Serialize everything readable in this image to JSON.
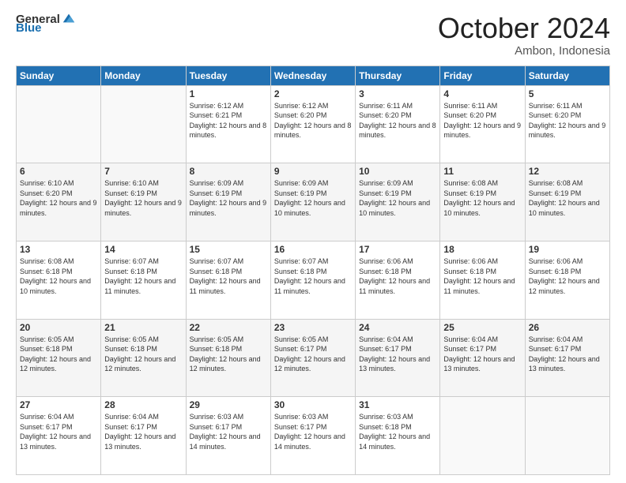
{
  "header": {
    "logo_general": "General",
    "logo_blue": "Blue",
    "month": "October 2024",
    "location": "Ambon, Indonesia"
  },
  "days_of_week": [
    "Sunday",
    "Monday",
    "Tuesday",
    "Wednesday",
    "Thursday",
    "Friday",
    "Saturday"
  ],
  "weeks": [
    [
      {
        "day": "",
        "sunrise": "",
        "sunset": "",
        "daylight": ""
      },
      {
        "day": "",
        "sunrise": "",
        "sunset": "",
        "daylight": ""
      },
      {
        "day": "1",
        "sunrise": "Sunrise: 6:12 AM",
        "sunset": "Sunset: 6:21 PM",
        "daylight": "Daylight: 12 hours and 8 minutes."
      },
      {
        "day": "2",
        "sunrise": "Sunrise: 6:12 AM",
        "sunset": "Sunset: 6:20 PM",
        "daylight": "Daylight: 12 hours and 8 minutes."
      },
      {
        "day": "3",
        "sunrise": "Sunrise: 6:11 AM",
        "sunset": "Sunset: 6:20 PM",
        "daylight": "Daylight: 12 hours and 8 minutes."
      },
      {
        "day": "4",
        "sunrise": "Sunrise: 6:11 AM",
        "sunset": "Sunset: 6:20 PM",
        "daylight": "Daylight: 12 hours and 9 minutes."
      },
      {
        "day": "5",
        "sunrise": "Sunrise: 6:11 AM",
        "sunset": "Sunset: 6:20 PM",
        "daylight": "Daylight: 12 hours and 9 minutes."
      }
    ],
    [
      {
        "day": "6",
        "sunrise": "Sunrise: 6:10 AM",
        "sunset": "Sunset: 6:20 PM",
        "daylight": "Daylight: 12 hours and 9 minutes."
      },
      {
        "day": "7",
        "sunrise": "Sunrise: 6:10 AM",
        "sunset": "Sunset: 6:19 PM",
        "daylight": "Daylight: 12 hours and 9 minutes."
      },
      {
        "day": "8",
        "sunrise": "Sunrise: 6:09 AM",
        "sunset": "Sunset: 6:19 PM",
        "daylight": "Daylight: 12 hours and 9 minutes."
      },
      {
        "day": "9",
        "sunrise": "Sunrise: 6:09 AM",
        "sunset": "Sunset: 6:19 PM",
        "daylight": "Daylight: 12 hours and 10 minutes."
      },
      {
        "day": "10",
        "sunrise": "Sunrise: 6:09 AM",
        "sunset": "Sunset: 6:19 PM",
        "daylight": "Daylight: 12 hours and 10 minutes."
      },
      {
        "day": "11",
        "sunrise": "Sunrise: 6:08 AM",
        "sunset": "Sunset: 6:19 PM",
        "daylight": "Daylight: 12 hours and 10 minutes."
      },
      {
        "day": "12",
        "sunrise": "Sunrise: 6:08 AM",
        "sunset": "Sunset: 6:19 PM",
        "daylight": "Daylight: 12 hours and 10 minutes."
      }
    ],
    [
      {
        "day": "13",
        "sunrise": "Sunrise: 6:08 AM",
        "sunset": "Sunset: 6:18 PM",
        "daylight": "Daylight: 12 hours and 10 minutes."
      },
      {
        "day": "14",
        "sunrise": "Sunrise: 6:07 AM",
        "sunset": "Sunset: 6:18 PM",
        "daylight": "Daylight: 12 hours and 11 minutes."
      },
      {
        "day": "15",
        "sunrise": "Sunrise: 6:07 AM",
        "sunset": "Sunset: 6:18 PM",
        "daylight": "Daylight: 12 hours and 11 minutes."
      },
      {
        "day": "16",
        "sunrise": "Sunrise: 6:07 AM",
        "sunset": "Sunset: 6:18 PM",
        "daylight": "Daylight: 12 hours and 11 minutes."
      },
      {
        "day": "17",
        "sunrise": "Sunrise: 6:06 AM",
        "sunset": "Sunset: 6:18 PM",
        "daylight": "Daylight: 12 hours and 11 minutes."
      },
      {
        "day": "18",
        "sunrise": "Sunrise: 6:06 AM",
        "sunset": "Sunset: 6:18 PM",
        "daylight": "Daylight: 12 hours and 11 minutes."
      },
      {
        "day": "19",
        "sunrise": "Sunrise: 6:06 AM",
        "sunset": "Sunset: 6:18 PM",
        "daylight": "Daylight: 12 hours and 12 minutes."
      }
    ],
    [
      {
        "day": "20",
        "sunrise": "Sunrise: 6:05 AM",
        "sunset": "Sunset: 6:18 PM",
        "daylight": "Daylight: 12 hours and 12 minutes."
      },
      {
        "day": "21",
        "sunrise": "Sunrise: 6:05 AM",
        "sunset": "Sunset: 6:18 PM",
        "daylight": "Daylight: 12 hours and 12 minutes."
      },
      {
        "day": "22",
        "sunrise": "Sunrise: 6:05 AM",
        "sunset": "Sunset: 6:18 PM",
        "daylight": "Daylight: 12 hours and 12 minutes."
      },
      {
        "day": "23",
        "sunrise": "Sunrise: 6:05 AM",
        "sunset": "Sunset: 6:17 PM",
        "daylight": "Daylight: 12 hours and 12 minutes."
      },
      {
        "day": "24",
        "sunrise": "Sunrise: 6:04 AM",
        "sunset": "Sunset: 6:17 PM",
        "daylight": "Daylight: 12 hours and 13 minutes."
      },
      {
        "day": "25",
        "sunrise": "Sunrise: 6:04 AM",
        "sunset": "Sunset: 6:17 PM",
        "daylight": "Daylight: 12 hours and 13 minutes."
      },
      {
        "day": "26",
        "sunrise": "Sunrise: 6:04 AM",
        "sunset": "Sunset: 6:17 PM",
        "daylight": "Daylight: 12 hours and 13 minutes."
      }
    ],
    [
      {
        "day": "27",
        "sunrise": "Sunrise: 6:04 AM",
        "sunset": "Sunset: 6:17 PM",
        "daylight": "Daylight: 12 hours and 13 minutes."
      },
      {
        "day": "28",
        "sunrise": "Sunrise: 6:04 AM",
        "sunset": "Sunset: 6:17 PM",
        "daylight": "Daylight: 12 hours and 13 minutes."
      },
      {
        "day": "29",
        "sunrise": "Sunrise: 6:03 AM",
        "sunset": "Sunset: 6:17 PM",
        "daylight": "Daylight: 12 hours and 14 minutes."
      },
      {
        "day": "30",
        "sunrise": "Sunrise: 6:03 AM",
        "sunset": "Sunset: 6:17 PM",
        "daylight": "Daylight: 12 hours and 14 minutes."
      },
      {
        "day": "31",
        "sunrise": "Sunrise: 6:03 AM",
        "sunset": "Sunset: 6:18 PM",
        "daylight": "Daylight: 12 hours and 14 minutes."
      },
      {
        "day": "",
        "sunrise": "",
        "sunset": "",
        "daylight": ""
      },
      {
        "day": "",
        "sunrise": "",
        "sunset": "",
        "daylight": ""
      }
    ]
  ]
}
